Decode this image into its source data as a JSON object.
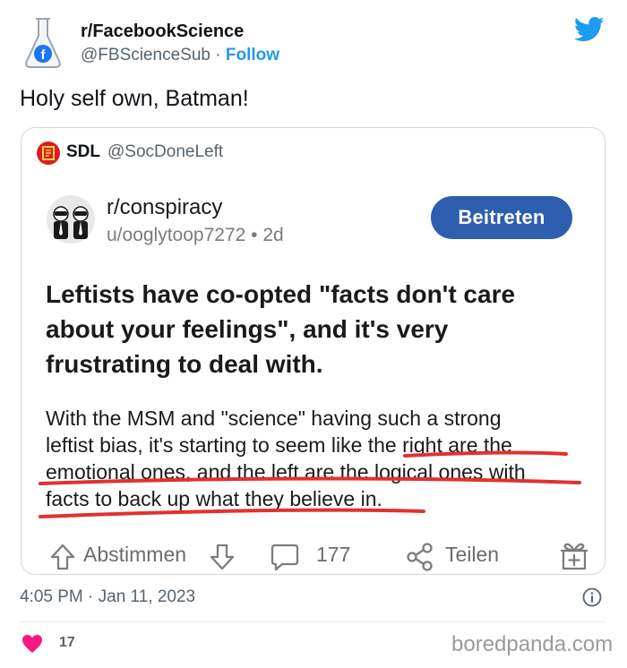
{
  "tweet": {
    "author_name": "r/FacebookScience",
    "author_handle": "@FBScienceSub",
    "separator": " · ",
    "follow_label": "Follow",
    "text": "Holy self own, Batman!",
    "timestamp": "4:05 PM · Jan 11, 2023",
    "likes": "17"
  },
  "quote": {
    "name": "SDL",
    "handle": "@SocDoneLeft"
  },
  "reddit": {
    "subreddit": "r/conspiracy",
    "user": "u/ooglytoop7272",
    "dot": " • ",
    "age": "2d",
    "join_label": "Beitreten",
    "title": "Leftists have co-opted \"facts don't care about your feelings\", and it's very frustrating to deal with.",
    "body_lines": [
      "With the MSM and \"science\" having such a strong",
      "leftist bias, it's starting to seem like the right are the",
      "emotional ones, and the left are the logical ones with",
      "facts to back up what they believe in."
    ],
    "vote_label": "Abstimmen",
    "comments": "177",
    "share_label": "Teilen"
  },
  "watermark": "boredpanda.com",
  "colors": {
    "twitter_blue": "#1d9bf0",
    "join_button": "#2d5eb0",
    "heart": "#f91880",
    "underline": "#e0322f"
  },
  "icons": [
    "flask-facebook-avatar",
    "twitter-bird-icon",
    "sdl-logo-icon",
    "reddit-avatar",
    "upvote-icon",
    "downvote-icon",
    "comment-icon",
    "share-icon",
    "gift-icon",
    "info-icon",
    "heart-icon"
  ]
}
